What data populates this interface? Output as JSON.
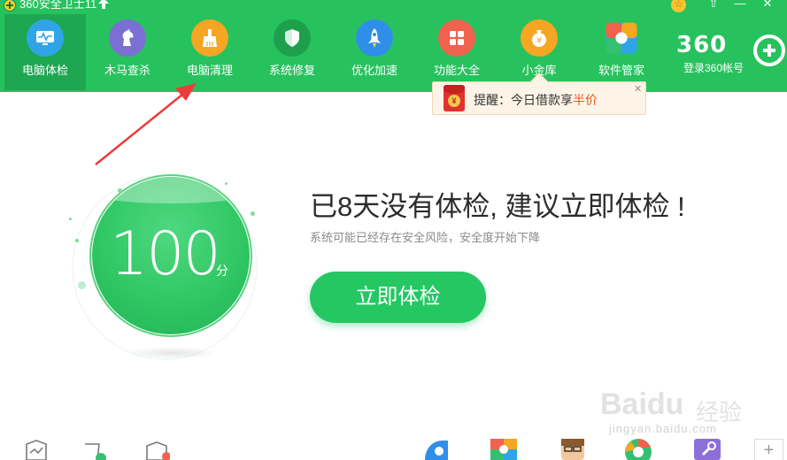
{
  "titlebar": {
    "app_title": "360安全卫士11",
    "star_glyph": "☆",
    "shirt_glyph": "⇧",
    "min_glyph": "—",
    "close_glyph": "✕"
  },
  "nav": {
    "items": [
      {
        "label": "电脑体检",
        "icon": "monitor-pulse-icon",
        "color": "#2fa5e8",
        "active": true
      },
      {
        "label": "木马查杀",
        "icon": "horse-icon",
        "color": "#7c6fd3",
        "active": false
      },
      {
        "label": "电脑清理",
        "icon": "broom-icon",
        "color": "#f5a623",
        "active": false
      },
      {
        "label": "系统修复",
        "icon": "shield-icon",
        "color": "#1d9f4c",
        "active": false
      },
      {
        "label": "优化加速",
        "icon": "rocket-icon",
        "color": "#2f8fe8",
        "active": false
      },
      {
        "label": "功能大全",
        "icon": "grid-icon",
        "color": "#f0624d",
        "active": false
      },
      {
        "label": "小金库",
        "icon": "money-bag-icon",
        "color": "#f5a623",
        "active": false
      },
      {
        "label": "软件管家",
        "icon": "app-flower-icon",
        "color": "#ffffff",
        "active": false
      }
    ]
  },
  "brand": {
    "logo_text": "360",
    "login_label": "登录360帐号"
  },
  "popup": {
    "prefix": "提醒：今日借款享",
    "highlight": "半价",
    "close_glyph": "✕",
    "yen": "¥"
  },
  "score": {
    "value": "100",
    "unit": "分"
  },
  "message": {
    "headline": "已8天没有体检, 建议立即体检 !",
    "subline": "系统可能已经存在安全风险，安全度开始下降",
    "check_button": "立即体检"
  },
  "watermark": {
    "logo": "Baidu",
    "cn": "经验",
    "url": "jingyan.baidu.com"
  },
  "bottom": {
    "more_glyph": "+"
  }
}
